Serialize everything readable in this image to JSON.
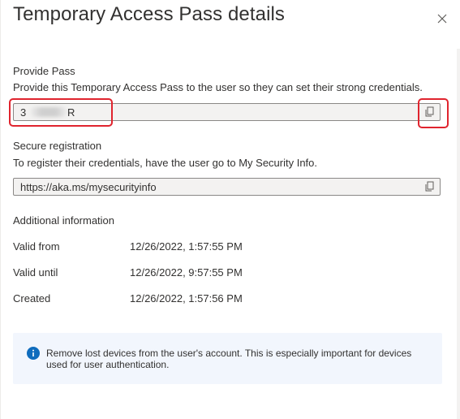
{
  "header": {
    "title": "Temporary Access Pass details",
    "close_label": "Close"
  },
  "provide_pass": {
    "label": "Provide Pass",
    "description": "Provide this Temporary Access Pass to the user so they can set their strong credentials.",
    "value_start": "3",
    "value_end": "R",
    "copy_icon": "copy-icon"
  },
  "secure_registration": {
    "label": "Secure registration",
    "description": "To register their credentials, have the user go to My Security Info.",
    "url": "https://aka.ms/mysecurityinfo",
    "copy_icon": "copy-icon"
  },
  "additional_info": {
    "heading": "Additional information",
    "rows": [
      {
        "key": "Valid from",
        "value": "12/26/2022, 1:57:55 PM"
      },
      {
        "key": "Valid until",
        "value": "12/26/2022, 9:57:55 PM"
      },
      {
        "key": "Created",
        "value": "12/26/2022, 1:57:56 PM"
      }
    ]
  },
  "banner": {
    "icon": "info-icon",
    "message": "Remove lost devices from the user's account. This is especially important for devices used for user authentication."
  },
  "colors": {
    "highlight": "#e0242e",
    "info_blue": "#0f6cbd",
    "banner_bg": "#f2f6fd",
    "field_bg": "#f3f2f1"
  }
}
